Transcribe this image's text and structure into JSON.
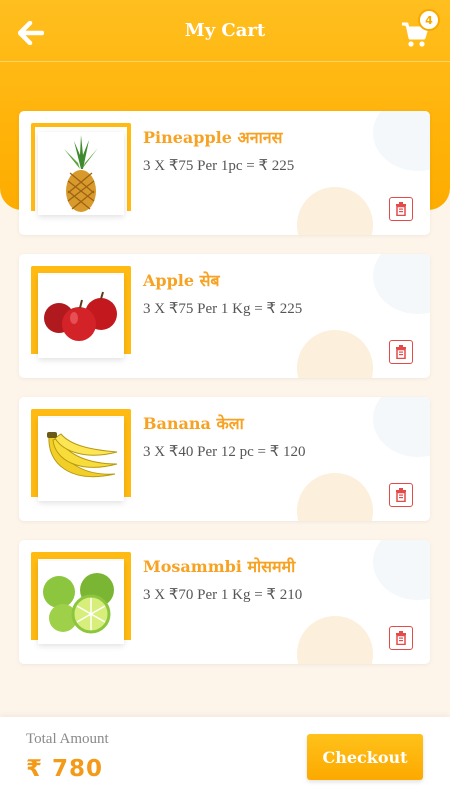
{
  "header": {
    "title": "My Cart",
    "back_icon": "arrow-left-icon",
    "cart_icon": "shopping-cart-icon",
    "cart_count": "4"
  },
  "colors": {
    "accent": "#ffb30a",
    "item_name": "#f7a223",
    "delete": "#e44a4a",
    "total": "#f39a18"
  },
  "items": [
    {
      "name": "Pineapple अनानस",
      "price_line": "3 X ₹75 Per 1pc = ₹ 225",
      "image": "pineapple-image"
    },
    {
      "name": "Apple सेब",
      "price_line": "3 X ₹75 Per 1 Kg = ₹ 225",
      "image": "apple-image"
    },
    {
      "name": "Banana केला",
      "price_line": "3 X ₹40 Per 12 pc = ₹ 120",
      "image": "banana-image"
    },
    {
      "name": "Mosammbi मोसममी",
      "price_line": "3 X ₹70 Per 1 Kg = ₹ 210",
      "image": "mosambi-image"
    }
  ],
  "footer": {
    "total_label": "Total Amount",
    "total_value": "₹ 780",
    "checkout_label": "Checkout"
  }
}
